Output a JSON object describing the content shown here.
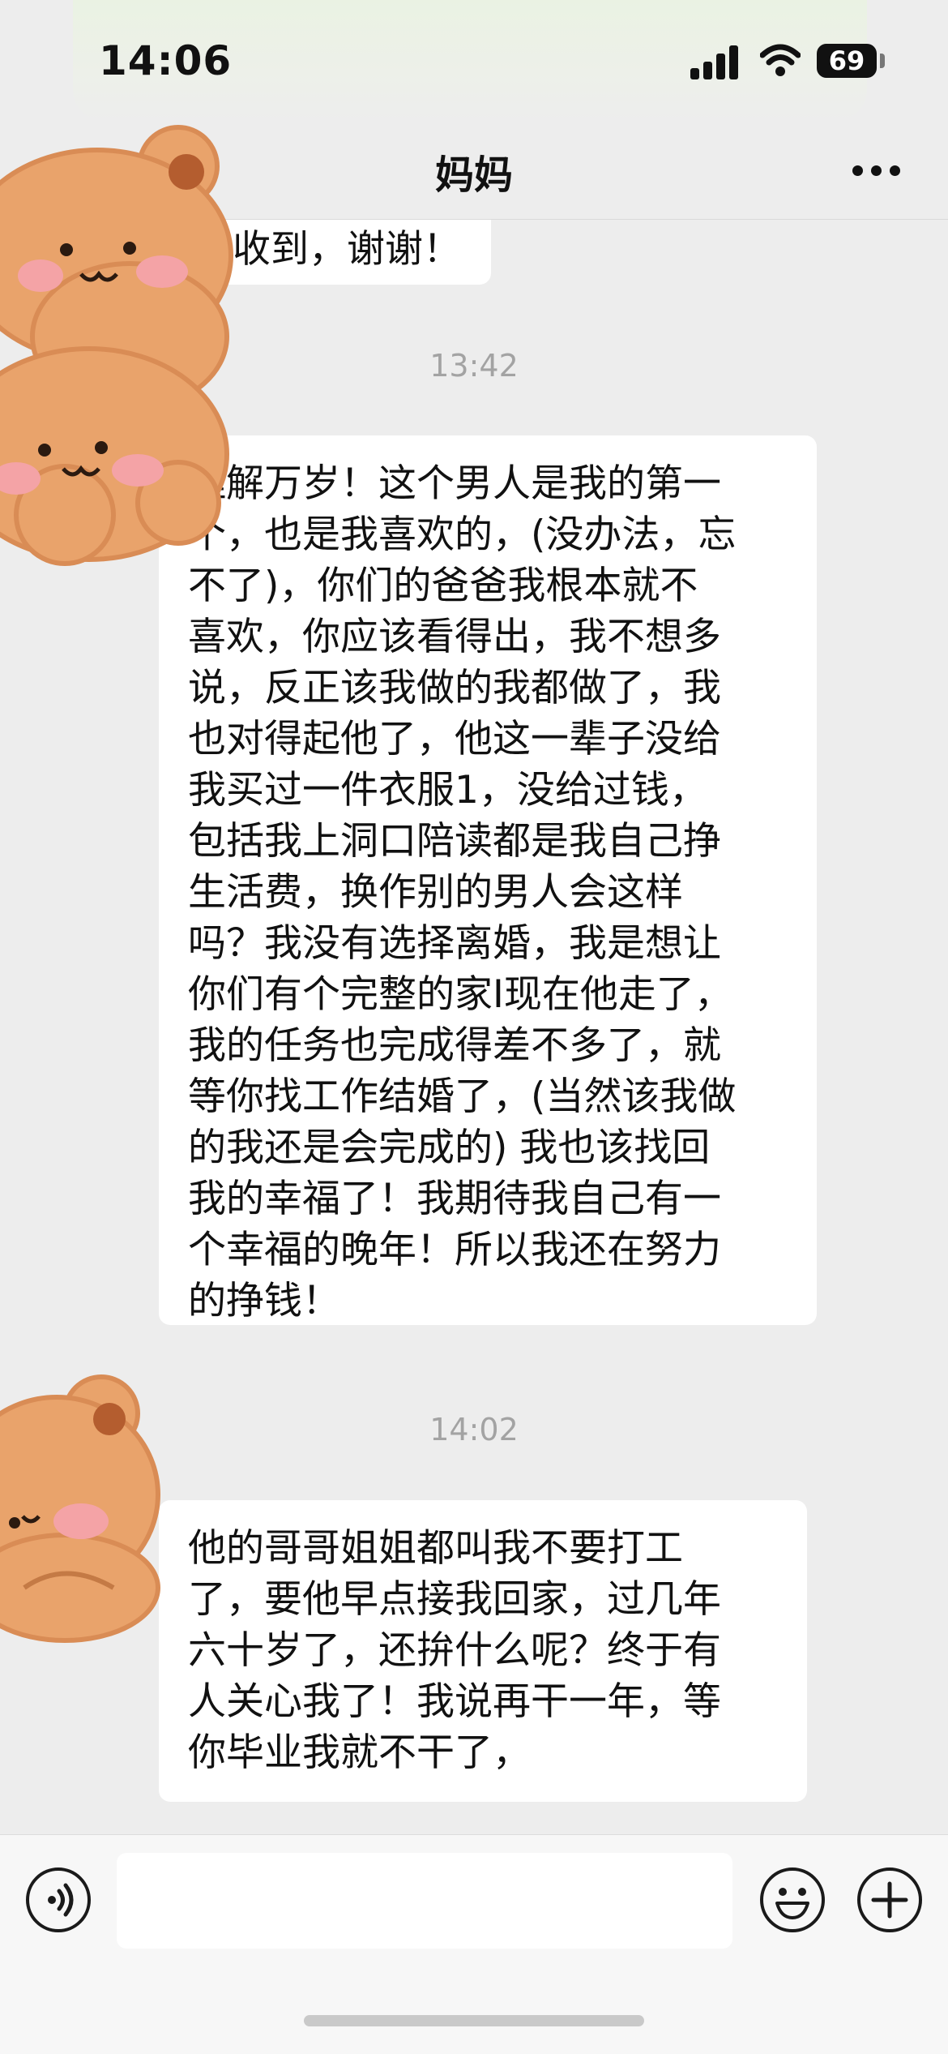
{
  "status": {
    "time": "14:06",
    "battery": "69"
  },
  "nav": {
    "title": "妈妈"
  },
  "messages": [
    {
      "lines": [
        "已收到，谢谢！"
      ]
    },
    {
      "timestamp": "13:42",
      "lines": [
        "理解万岁！这个男人是我的第一",
        "个，也是我喜欢的，(没办法，忘",
        "不了)，你们的爸爸我根本就不",
        "喜欢，你应该看得出，我不想多",
        "说，反正该我做的我都做了，我",
        "也对得起他了，他这一辈子没给",
        "我买过一件衣服1，没给过钱，",
        "包括我上洞口陪读都是我自己挣",
        "生活费，换作别的男人会这样",
        "吗？我没有选择离婚，我是想让",
        "你们有个完整的家I现在他走了，",
        "我的任务也完成得差不多了，就",
        "等你找工作结婚了，(当然该我做",
        "的我还是会完成的) 我也该找回",
        "我的幸福了！我期待我自己有一",
        "个幸福的晚年！所以我还在努力",
        "的挣钱！"
      ]
    },
    {
      "timestamp": "14:02",
      "lines": [
        "他的哥哥姐姐都叫我不要打工",
        "了，要他早点接我回家，过几年",
        "六十岁了，还拚什么呢？终于有",
        "人关心我了！我说再干一年，等",
        "你毕业我就不干了，"
      ]
    }
  ],
  "icons": {
    "back": "chevron-left-icon",
    "more": "more-dots-icon",
    "voice": "voice-icon",
    "emoji": "emoji-icon",
    "plus": "plus-icon",
    "sticker": "bear-sticker"
  },
  "colors": {
    "background": "#ededed",
    "bubble": "#ffffff",
    "sticker": "#e9a36b"
  }
}
